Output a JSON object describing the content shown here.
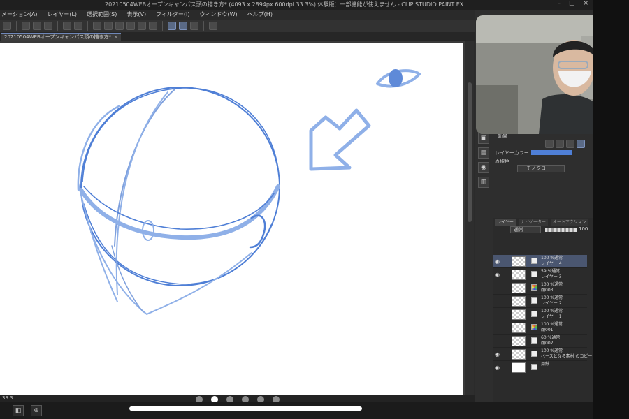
{
  "window": {
    "title": "20210504WEBオープンキャンパス頭の描き方* (4093 x 2894px 600dpi 33.3%)  体験版：一部機能が使えません - CLIP STUDIO PAINT EX",
    "controls": [
      "–",
      "□",
      "×"
    ]
  },
  "menu": [
    "メーション(A)",
    "レイヤー(L)",
    "選択範囲(S)",
    "表示(V)",
    "フィルター(I)",
    "ウィンドウ(W)",
    "ヘルプ(H)"
  ],
  "tab": {
    "label": "20210504WEBオープンキャンパス頭の描き方*",
    "close": "×"
  },
  "status": {
    "zoom": "33.3"
  },
  "page_dots": {
    "count": 6,
    "active": 1
  },
  "property_panel": {
    "effect_label": "効果",
    "layer_color_label": "レイヤーカラー",
    "expression_label": "表現色",
    "expression_value": "モノクロ",
    "colors": {
      "layer_color": "#4f7fd6"
    }
  },
  "layer_panel": {
    "tabs": [
      "レイヤー",
      "ナビゲーター",
      "オートアクション"
    ],
    "blend_mode": "通常",
    "opacity": "100",
    "layers": [
      {
        "opacity_mode": "100 %通常",
        "name": "レイヤー 4",
        "selected": true,
        "visible": true,
        "mark": "none"
      },
      {
        "opacity_mode": "59 %通常",
        "name": "レイヤー 3",
        "selected": false,
        "visible": true,
        "mark": "none"
      },
      {
        "opacity_mode": "100 %通常",
        "name": "顔003",
        "selected": false,
        "visible": false,
        "mark": "color"
      },
      {
        "opacity_mode": "100 %通常",
        "name": "レイヤー 2",
        "selected": false,
        "visible": false,
        "mark": "none"
      },
      {
        "opacity_mode": "100 %通常",
        "name": "レイヤー 1",
        "selected": false,
        "visible": false,
        "mark": "none"
      },
      {
        "opacity_mode": "100 %通常",
        "name": "顔001",
        "selected": false,
        "visible": false,
        "mark": "color"
      },
      {
        "opacity_mode": "60 %通常",
        "name": "顔002",
        "selected": false,
        "visible": false,
        "mark": "gray"
      },
      {
        "opacity_mode": "100 %通常",
        "name": "ベースとなる素材 のコピー",
        "selected": false,
        "visible": true,
        "mark": "none"
      },
      {
        "opacity_mode": "",
        "name": "用紙",
        "selected": false,
        "visible": true,
        "mark": "paper"
      }
    ]
  },
  "colors": {
    "sketch_blue": "#4f7fd6",
    "sketch_light_blue": "#8fb0e8",
    "accent": "#6f87b8"
  }
}
